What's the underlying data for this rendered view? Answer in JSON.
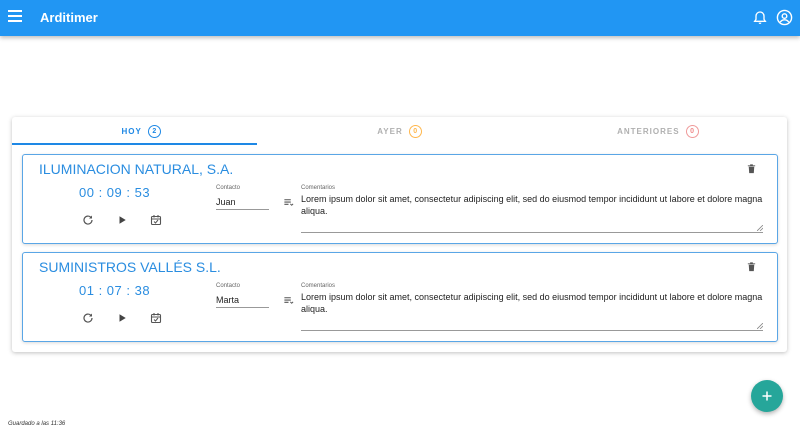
{
  "app": {
    "title": "Arditimer"
  },
  "icons": {
    "menu": "menu-icon",
    "bell": "bell-icon",
    "account": "account-circle-icon",
    "trash": "trash-icon",
    "reset": "reset-icon",
    "play": "play-icon",
    "calendar": "calendar-check-icon",
    "notes": "notes-icon",
    "add": "plus-icon"
  },
  "colors": {
    "primary": "#2196f3",
    "accent": "#26a69a",
    "client": "#2a8de0",
    "warn": "#ffb74d",
    "alert": "#ef8a8a"
  },
  "tabs": [
    {
      "label": "HOY",
      "count": "2"
    },
    {
      "label": "AYER",
      "count": "0"
    },
    {
      "label": "ANTERIORES",
      "count": "0"
    }
  ],
  "entries": [
    {
      "client": "ILUMINACION NATURAL, S.A.",
      "timer": "00 : 09 : 53",
      "contact_label": "Contacto",
      "contact": "Juan",
      "comments_label": "Comentarios",
      "comments_text": "Lorem ipsum dolor sit amet, consectetur adipiscing elit, sed do eiusmod tempor incididunt ut labore et dolore magna aliqua."
    },
    {
      "client": "SUMINISTROS VALLÉS S.L.",
      "timer": "01 : 07 : 38",
      "contact_label": "Contacto",
      "contact": "Marta",
      "comments_label": "Comentarios",
      "comments_text": "Lorem ipsum dolor sit amet, consectetur adipiscing elit, sed do eiusmod tempor incididunt ut labore et dolore magna aliqua."
    }
  ],
  "footer": {
    "saved": "Guardado a las 11:36"
  }
}
